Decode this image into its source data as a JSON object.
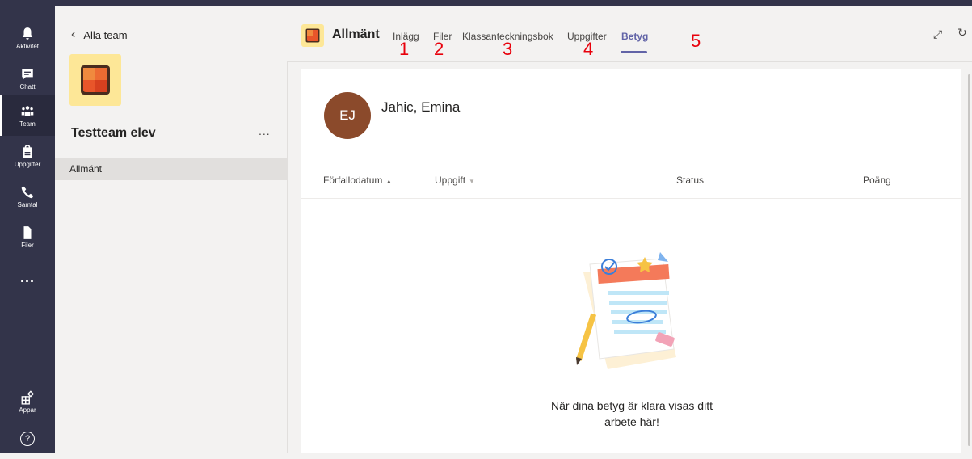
{
  "rail": {
    "items": [
      {
        "label": "Aktivitet",
        "icon": "bell-icon"
      },
      {
        "label": "Chatt",
        "icon": "chat-icon"
      },
      {
        "label": "Team",
        "icon": "team-icon"
      },
      {
        "label": "Uppgifter",
        "icon": "assignments-icon"
      },
      {
        "label": "Samtal",
        "icon": "phone-icon"
      },
      {
        "label": "Filer",
        "icon": "file-icon"
      }
    ],
    "more": "...",
    "apps_label": "Appar",
    "help_symbol": "?"
  },
  "panel": {
    "back_label": "Alla team",
    "team_name": "Testteam elev",
    "more": "...",
    "channel": "Allmänt"
  },
  "header": {
    "title": "Allmänt",
    "tabs": [
      "Inlägg",
      "Filer",
      "Klassanteckningsbok",
      "Uppgifter",
      "Betyg"
    ],
    "active_tab": "Betyg",
    "annotations": [
      "1",
      "2",
      "3",
      "4",
      "5"
    ],
    "accent_color": "#6264a7",
    "annotation_color": "#e8000b"
  },
  "student": {
    "initials": "EJ",
    "name": "Jahic, Emina"
  },
  "table": {
    "columns": [
      "Förfallodatum",
      "Uppgift",
      "Status",
      "Poäng"
    ]
  },
  "empty_state": {
    "line1": "När dina betyg är klara visas ditt",
    "line2": "arbete här!"
  }
}
